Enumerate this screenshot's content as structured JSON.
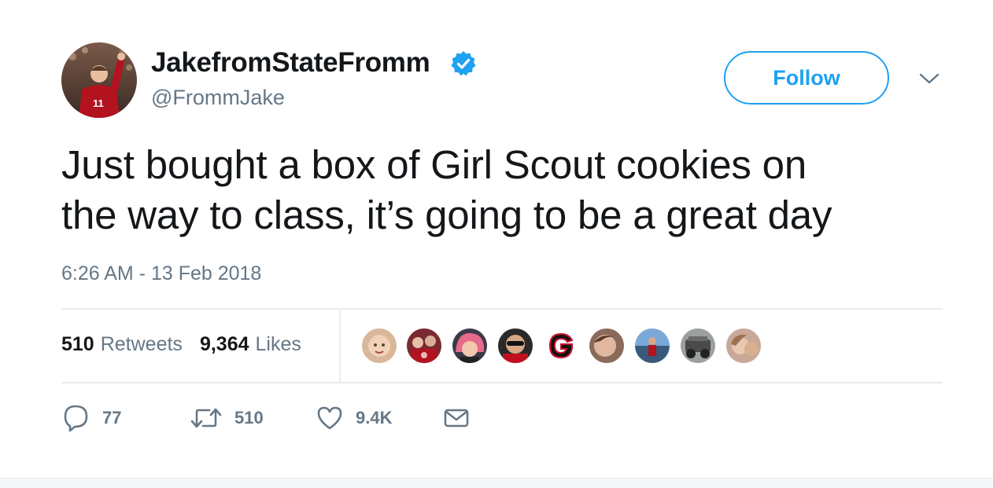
{
  "tweet": {
    "author": {
      "display_name": "JakefromStateFromm",
      "handle": "@FrommJake",
      "verified": true,
      "avatar_icon": "profile-photo"
    },
    "follow_label": "Follow",
    "text_lines": [
      "Just bought a box of Girl Scout cookies on",
      "the way to class, it’s going to be a great day"
    ],
    "timestamp": "6:26 AM - 13 Feb 2018",
    "stats": {
      "retweets_count": "510",
      "retweets_label": "Retweets",
      "likes_count": "9,364",
      "likes_label": "Likes"
    },
    "liker_avatars": [
      {
        "icon": "child-photo"
      },
      {
        "icon": "group-photo"
      },
      {
        "icon": "pink-hair-photo"
      },
      {
        "icon": "sunglasses-photo"
      },
      {
        "icon": "georgia-g-logo"
      },
      {
        "icon": "face-photo"
      },
      {
        "icon": "outdoor-photo"
      },
      {
        "icon": "vehicle-photo"
      },
      {
        "icon": "selfie-photo"
      }
    ],
    "actions": {
      "reply_count": "77",
      "retweet_count": "510",
      "like_count": "9.4K"
    }
  },
  "colors": {
    "link_blue": "#1da1f2",
    "text_primary": "#14171a",
    "text_secondary": "#657786",
    "divider": "#e6ecf0"
  }
}
